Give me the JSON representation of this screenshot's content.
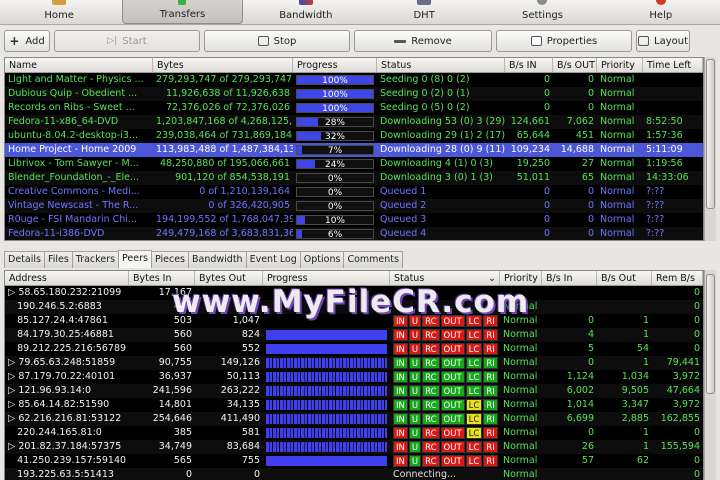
{
  "nav": [
    {
      "label": "Home",
      "icon": "home-icon"
    },
    {
      "label": "Transfers",
      "icon": "transfers-icon"
    },
    {
      "label": "Bandwidth",
      "icon": "bandwidth-icon"
    },
    {
      "label": "DHT",
      "icon": "dht-icon"
    },
    {
      "label": "Settings",
      "icon": "settings-icon"
    },
    {
      "label": "Help",
      "icon": "help-icon"
    }
  ],
  "toolbar": {
    "add": "Add",
    "start": "Start",
    "stop": "Stop",
    "remove": "Remove",
    "properties": "Properties",
    "layout": "Layout"
  },
  "torrents": {
    "columns": [
      "Name",
      "Bytes",
      "Progress",
      "Status",
      "B/s IN",
      "B/s OUT",
      "Priority",
      "Time Left"
    ],
    "rows": [
      {
        "name": "Light and Matter - Physics ...",
        "bytes": "279,293,747 of 279,293,747",
        "progress": 100,
        "progress_label": "100%",
        "status": "Seeding 0 (8) 0 (2)",
        "bin": "0",
        "bout": "0",
        "priority": "Normal",
        "time_left": "",
        "color": "green"
      },
      {
        "name": "Dubious Quip - Obedient ...",
        "bytes": "11,926,638 of 11,926,638",
        "progress": 100,
        "progress_label": "100%",
        "status": "Seeding 0 (2) 0 (1)",
        "bin": "0",
        "bout": "0",
        "priority": "Normal",
        "time_left": "",
        "color": "green"
      },
      {
        "name": "Records on Ribs - Sweet ...",
        "bytes": "72,376,026 of 72,376,026",
        "progress": 100,
        "progress_label": "100%",
        "status": "Seeding 0 (5) 0 (2)",
        "bin": "0",
        "bout": "0",
        "priority": "Normal",
        "time_left": "",
        "color": "green"
      },
      {
        "name": "Fedora-11-x86_64-DVD",
        "bytes": "1,203,847,168 of 4,268,125,",
        "progress": 28,
        "progress_label": "28%",
        "status": "Downloading 53 (0) 3 (29)",
        "bin": "124,661",
        "bout": "7,062",
        "priority": "Normal",
        "time_left": "8:52:50",
        "color": "green"
      },
      {
        "name": "ubuntu-8.04.2-desktop-i3...",
        "bytes": "239,038,464 of 731,869,184",
        "progress": 32,
        "progress_label": "32%",
        "status": "Downloading 29 (1) 2 (17)",
        "bin": "65,644",
        "bout": "451",
        "priority": "Normal",
        "time_left": "1:57:36",
        "color": "green"
      },
      {
        "name": "Home Project - Home 2009",
        "bytes": "113,983,488 of 1,487,384,13",
        "progress": 7,
        "progress_label": "7%",
        "status": "Downloading 28 (0) 9 (11)",
        "bin": "109,234",
        "bout": "14,688",
        "priority": "Normal",
        "time_left": "5:11:09",
        "color": "green",
        "selected": true
      },
      {
        "name": "Librivox - Tom Sawyer - M...",
        "bytes": "48,250,880 of 195,066,661",
        "progress": 24,
        "progress_label": "24%",
        "status": "Downloading 4 (1) 0 (3)",
        "bin": "19,250",
        "bout": "27",
        "priority": "Normal",
        "time_left": "1:19:56",
        "color": "green"
      },
      {
        "name": "Blender_Foundation_-_Ele...",
        "bytes": "901,120 of 854,538,191",
        "progress": 0,
        "progress_label": "0%",
        "status": "Downloading 3 (0) 1 (3)",
        "bin": "51,011",
        "bout": "65",
        "priority": "Normal",
        "time_left": "14:33:06",
        "color": "green"
      },
      {
        "name": "Creative Commons - Medi...",
        "bytes": "0 of 1,210,139,164",
        "progress": 0,
        "progress_label": "0%",
        "status": "Queued 1",
        "bin": "0",
        "bout": "0",
        "priority": "Normal",
        "time_left": "?:??",
        "color": "blue"
      },
      {
        "name": "Vintage Newscast - The R...",
        "bytes": "0 of 326,420,905",
        "progress": 0,
        "progress_label": "0%",
        "status": "Queued 2",
        "bin": "0",
        "bout": "0",
        "priority": "Normal",
        "time_left": "?:??",
        "color": "blue"
      },
      {
        "name": "R0uge - FSI Mandarin Chi...",
        "bytes": "194,199,552 of 1,768,047,39",
        "progress": 10,
        "progress_label": "10%",
        "status": "Queued 3",
        "bin": "0",
        "bout": "0",
        "priority": "Normal",
        "time_left": "?:??",
        "color": "blue"
      },
      {
        "name": "Fedora-11-i386-DVD",
        "bytes": "249,479,168 of 3,683,831,36",
        "progress": 6,
        "progress_label": "6%",
        "status": "Queued 4",
        "bin": "0",
        "bout": "0",
        "priority": "Normal",
        "time_left": "?:??",
        "color": "blue"
      }
    ]
  },
  "tabs": [
    "Details",
    "Files",
    "Trackers",
    "Peers",
    "Pieces",
    "Bandwidth",
    "Event Log",
    "Options",
    "Comments"
  ],
  "active_tab": "Peers",
  "peers": {
    "columns": [
      "Address",
      "Bytes In",
      "Bytes Out",
      "Progress",
      "Status",
      "Priority",
      "B/s In",
      "B/s Out",
      "Rem B/s"
    ],
    "rows": [
      {
        "address": "58.65.180.232:21099",
        "bin": "17,167",
        "bout": "",
        "progress": 0,
        "flags": null,
        "priority": "",
        "bsin": "",
        "bsout": "",
        "rem": "0",
        "expand": true
      },
      {
        "address": "190.246.5.2:6883",
        "bin": "446",
        "bout": "",
        "progress": 0,
        "flags": null,
        "priority": "Normal",
        "bsin": "",
        "bsout": "",
        "rem": "0"
      },
      {
        "address": "85.127.24.4:47861",
        "bin": "503",
        "bout": "1,047",
        "progress": 0,
        "flags": [
          "r",
          "r",
          "r",
          "r",
          "r",
          "r"
        ],
        "priority": "Normal",
        "bsin": "0",
        "bsout": "1",
        "rem": "0"
      },
      {
        "address": "84.179.30.25:46881",
        "bin": "560",
        "bout": "824",
        "progress": 100,
        "flags": [
          "r",
          "r",
          "r",
          "r",
          "r",
          "r"
        ],
        "priority": "Normal",
        "bsin": "4",
        "bsout": "1",
        "rem": "0"
      },
      {
        "address": "89.212.225.216:56789",
        "bin": "560",
        "bout": "552",
        "progress": 100,
        "flags": [
          "r",
          "r",
          "r",
          "r",
          "r",
          "r"
        ],
        "priority": "Normal",
        "bsin": "5",
        "bsout": "54",
        "rem": "0"
      },
      {
        "address": "79.65.63.248:51859",
        "bin": "90,755",
        "bout": "149,126",
        "progress": 100,
        "stripes": true,
        "flags": [
          "g",
          "g",
          "g",
          "g",
          "g",
          "g"
        ],
        "priority": "Normal",
        "bsin": "0",
        "bsout": "1",
        "rem": "79,441",
        "expand": true
      },
      {
        "address": "87.179.70.22:40101",
        "bin": "36,937",
        "bout": "50,113",
        "progress": 100,
        "stripes": true,
        "flags": [
          "g",
          "g",
          "g",
          "g",
          "g",
          "g"
        ],
        "priority": "Normal",
        "bsin": "1,124",
        "bsout": "1,034",
        "rem": "3,972",
        "expand": true
      },
      {
        "address": "121.96.93.14:0",
        "bin": "241,596",
        "bout": "263,222",
        "progress": 100,
        "stripes": true,
        "flags": [
          "g",
          "g",
          "g",
          "g",
          "g",
          "g"
        ],
        "priority": "Normal",
        "bsin": "6,002",
        "bsout": "9,505",
        "rem": "47,664",
        "expand": true
      },
      {
        "address": "85.64.14.82:51590",
        "bin": "14,801",
        "bout": "34,135",
        "progress": 100,
        "stripes": true,
        "flags": [
          "g",
          "g",
          "g",
          "g",
          "y",
          "g"
        ],
        "priority": "Normal",
        "bsin": "1,014",
        "bsout": "3,347",
        "rem": "3,972",
        "expand": true
      },
      {
        "address": "62.216.216.81:53122",
        "bin": "254,646",
        "bout": "411,490",
        "progress": 100,
        "stripes": true,
        "flags": [
          "g",
          "g",
          "g",
          "g",
          "y",
          "g"
        ],
        "priority": "Normal",
        "bsin": "6,699",
        "bsout": "2,885",
        "rem": "162,855",
        "expand": true
      },
      {
        "address": "220.244.165.81:0",
        "bin": "385",
        "bout": "581",
        "progress": 100,
        "stripes": true,
        "flags": [
          "r",
          "g",
          "r",
          "r",
          "y",
          "r"
        ],
        "priority": "Normal",
        "bsin": "0",
        "bsout": "1",
        "rem": "0"
      },
      {
        "address": "201.82.37.184:57375",
        "bin": "34,749",
        "bout": "83,684",
        "progress": 100,
        "stripes": true,
        "flags": [
          "r",
          "g",
          "r",
          "r",
          "r",
          "r"
        ],
        "priority": "Normal",
        "bsin": "26",
        "bsout": "1",
        "rem": "155,594",
        "expand": true
      },
      {
        "address": "41.250.239.157:59140",
        "bin": "565",
        "bout": "755",
        "progress": 100,
        "flags": [
          "r",
          "g",
          "r",
          "r",
          "r",
          "r"
        ],
        "priority": "Normal",
        "bsin": "57",
        "bsout": "62",
        "rem": "0"
      },
      {
        "address": "193.225.63.5:51413",
        "bin": "0",
        "bout": "0",
        "progress": 0,
        "status_text": "Connecting...",
        "priority": "Normal",
        "bsin": "",
        "bsout": "",
        "rem": "0"
      }
    ]
  },
  "flag_labels": [
    "IN",
    "U",
    "RC",
    "OUT",
    "LC",
    "RI"
  ],
  "watermark": "www.MyFileCR.com",
  "colors": {
    "seeding": "#59e05a",
    "queued": "#6f74ff",
    "selected": "#4b56d8",
    "progress": "#4045e6"
  }
}
